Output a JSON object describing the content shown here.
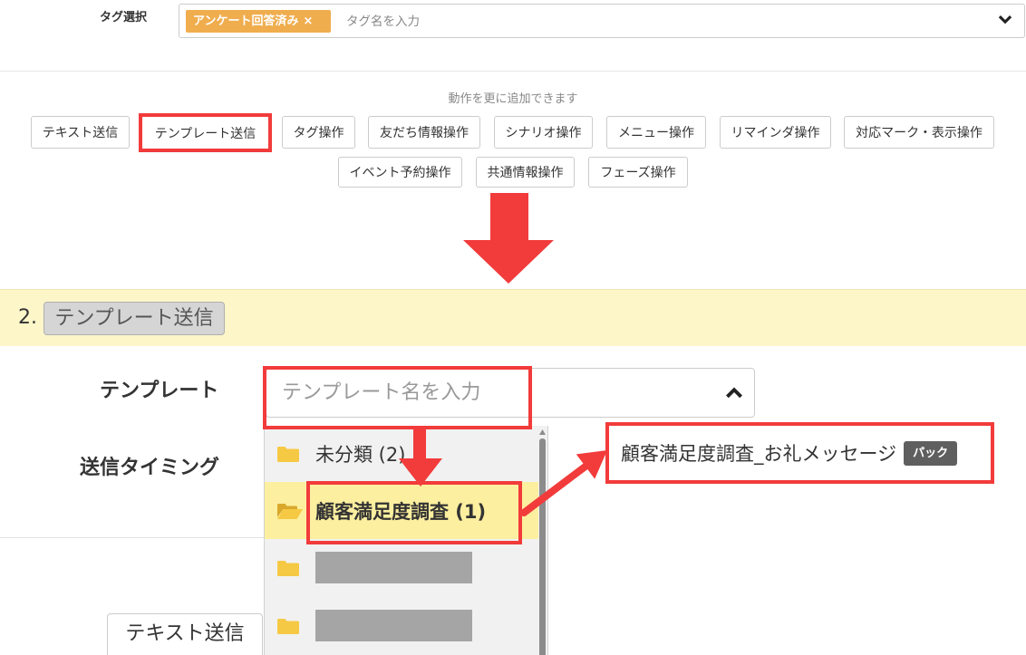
{
  "colors": {
    "annotation_red": "#f23b3b",
    "tag_chip": "#f0ad4e",
    "step_band": "#fcf6c9",
    "selected_row": "#fcef9f",
    "folder": "#f6c944",
    "badge": "#5f5f5f"
  },
  "tag_select": {
    "label": "タグ選択",
    "selected_tags": [
      {
        "label": "アンケート回答済み",
        "remove": "×"
      }
    ],
    "placeholder": "タグ名を入力",
    "toggle_icon": "chevron-down-icon"
  },
  "actions": {
    "hint": "動作を更に追加できます",
    "buttons": [
      {
        "label": "テキスト送信",
        "highlighted": false
      },
      {
        "label": "テンプレート送信",
        "highlighted": true
      },
      {
        "label": "タグ操作",
        "highlighted": false
      },
      {
        "label": "友だち情報操作",
        "highlighted": false
      },
      {
        "label": "シナリオ操作",
        "highlighted": false
      },
      {
        "label": "メニュー操作",
        "highlighted": false
      },
      {
        "label": "リマインダ操作",
        "highlighted": false
      },
      {
        "label": "対応マーク・表示操作",
        "highlighted": false
      },
      {
        "label": "イベント予約操作",
        "highlighted": false
      },
      {
        "label": "共通情報操作",
        "highlighted": false
      },
      {
        "label": "フェーズ操作",
        "highlighted": false
      }
    ]
  },
  "step": {
    "number": "2.",
    "action": "テンプレート送信"
  },
  "template": {
    "label": "テンプレート",
    "placeholder": "テンプレート名を入力",
    "toggle_icon": "chevron-up-icon",
    "folders": [
      {
        "name": "未分類 (2)",
        "icon": "folder-icon",
        "open": false,
        "selected": false
      },
      {
        "name": "顧客満足度調査 (1)",
        "icon": "folder-open-icon",
        "open": true,
        "selected": true
      },
      {
        "icon": "folder-icon",
        "redacted": true
      },
      {
        "icon": "folder-icon",
        "redacted": true
      }
    ],
    "items": [
      {
        "name": "顧客満足度調査_お礼メッセージ",
        "badge": "パック"
      }
    ]
  },
  "send_timing": {
    "label": "送信タイミング"
  },
  "message_tabs": [
    "テキスト送信"
  ]
}
